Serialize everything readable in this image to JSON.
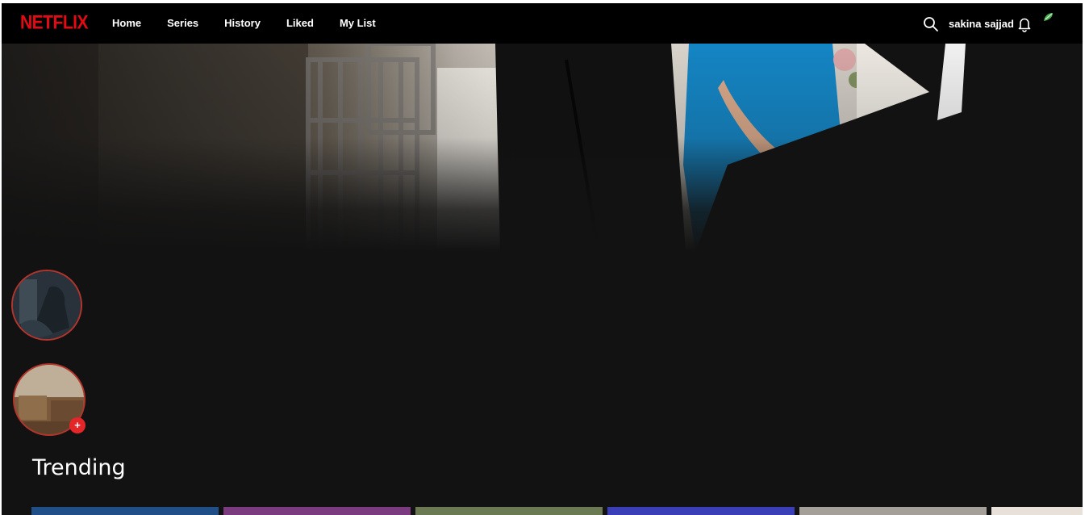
{
  "brand": {
    "logo_text": "NETFLIX",
    "logo_color": "#e50914"
  },
  "nav": {
    "items": [
      {
        "label": "Home"
      },
      {
        "label": "Series"
      },
      {
        "label": "History"
      },
      {
        "label": "Liked"
      },
      {
        "label": "My List"
      }
    ]
  },
  "header_right": {
    "username": "sakina sajjad",
    "icons": [
      "search-icon",
      "bell-icon",
      "avatar-icon"
    ]
  },
  "hero": {
    "image": "hero-image"
  },
  "stories": {
    "items": [
      {
        "name": "story-thumbnail"
      },
      {
        "name": "story-thumbnail",
        "badge": "+"
      }
    ],
    "ring_color": "#b3342c",
    "badge_color": "#e52629"
  },
  "trending": {
    "title": "Trending",
    "cards": [
      {
        "color": "#1f4f86"
      },
      {
        "color": "#7a3c7e"
      },
      {
        "color": "#6b7a52"
      },
      {
        "color": "#3b3fb7"
      },
      {
        "color": "#a4a099"
      },
      {
        "color": "#e7e1d9"
      }
    ]
  },
  "colors": {
    "background": "#121212",
    "topbar": "#000000",
    "text": "#ffffff"
  }
}
